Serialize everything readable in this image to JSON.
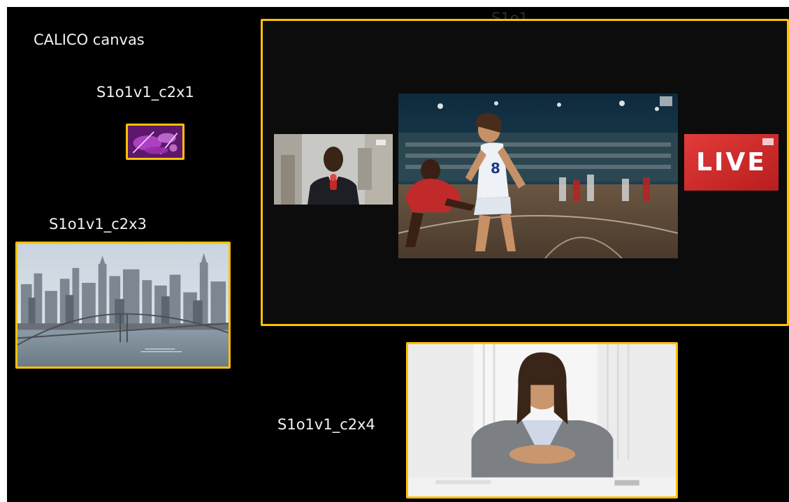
{
  "canvas": {
    "title": "CALICO canvas",
    "background": "#000000",
    "frame_color": "#ffc107"
  },
  "windows": {
    "c2x1": {
      "label": "S1o1v1_c2x1",
      "content": "purple drum-kit thumbnail"
    },
    "c2x3": {
      "label": "S1o1v1_c2x3",
      "content": "city skyline with bridge"
    },
    "c2x4": {
      "label": "S1o1v1_c2x4",
      "content": "woman seated at desk"
    },
    "main": {
      "label_partial": "S1o1",
      "tiles": {
        "reporter": {
          "name": "news reporter with microphone"
        },
        "game": {
          "name": "basketball game",
          "jersey_number": "8"
        },
        "live": {
          "text": "LIVE",
          "color": "#d62828"
        }
      }
    }
  }
}
